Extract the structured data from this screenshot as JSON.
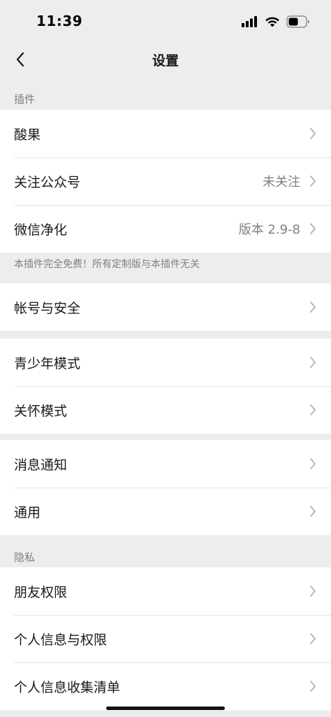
{
  "status_bar": {
    "time": "11:39",
    "icons": [
      "signal-icon",
      "wifi-icon",
      "battery-icon"
    ]
  },
  "nav": {
    "back_icon": "chevron-left-icon",
    "title": "设置"
  },
  "plugins_section": {
    "header": "插件",
    "items": [
      {
        "label": "酸果",
        "value": ""
      },
      {
        "label": "关注公众号",
        "value": "未关注"
      },
      {
        "label": "微信净化",
        "value": "版本 2.9-8"
      }
    ],
    "note": "本插件完全免费！所有定制版与本插件无关"
  },
  "account_group": {
    "items": [
      {
        "label": "帐号与安全"
      }
    ]
  },
  "mode_group": {
    "items": [
      {
        "label": "青少年模式"
      },
      {
        "label": "关怀模式"
      }
    ]
  },
  "general_group": {
    "items": [
      {
        "label": "消息通知"
      },
      {
        "label": "通用"
      }
    ]
  },
  "privacy_section": {
    "header": "隐私",
    "items": [
      {
        "label": "朋友权限"
      },
      {
        "label": "个人信息与权限"
      },
      {
        "label": "个人信息收集清单"
      }
    ]
  },
  "colors": {
    "background": "#ededed",
    "cell_background": "#ffffff",
    "primary_text": "#191919",
    "secondary_text": "#7f7f7f",
    "separator": "#e5e5e5",
    "chevron": "#b2b2b2"
  }
}
